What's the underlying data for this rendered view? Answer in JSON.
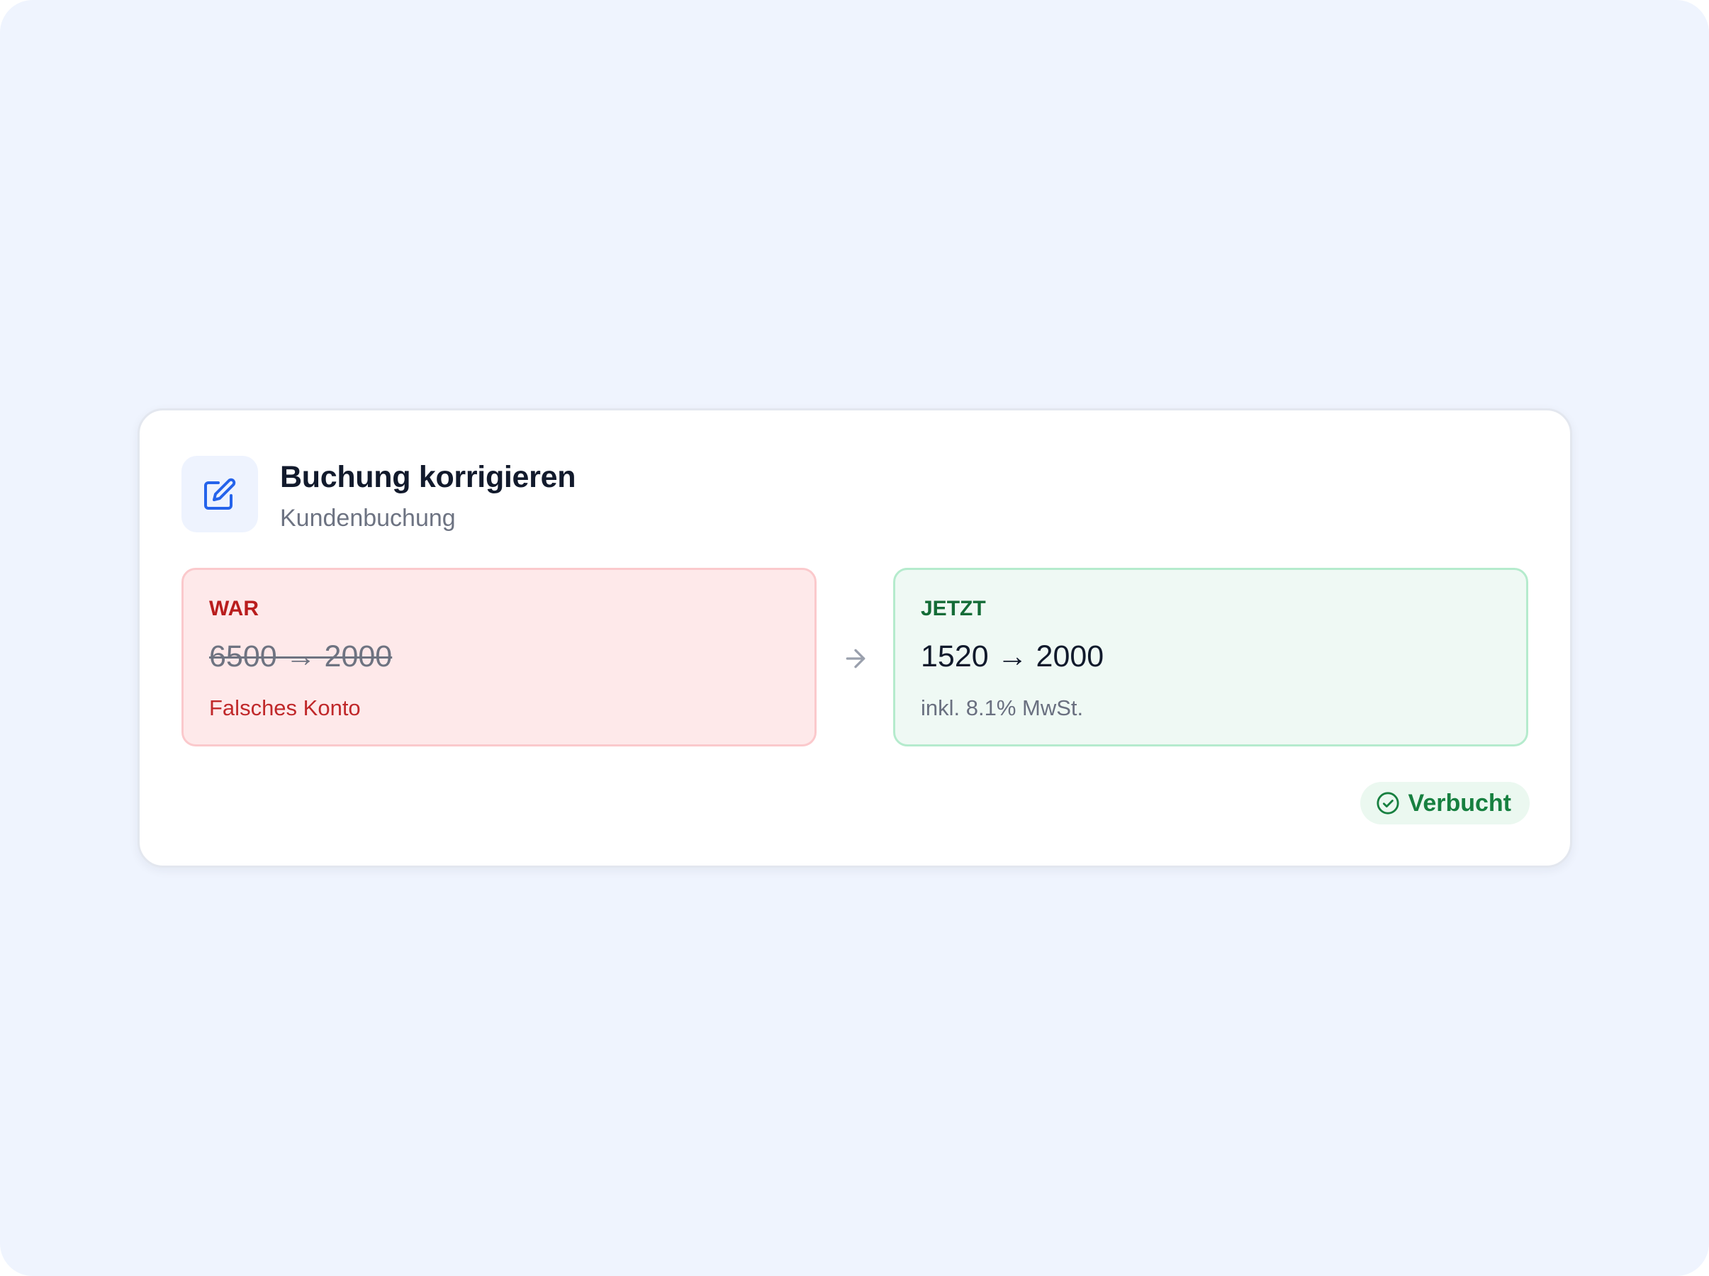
{
  "header": {
    "icon": "edit-icon",
    "title": "Buchung korrigieren",
    "subtitle": "Kundenbuchung"
  },
  "was": {
    "label": "WAR",
    "value": "6500 → 2000",
    "note": "Falsches Konto"
  },
  "transition_icon": "arrow-right-icon",
  "now": {
    "label": "JETZT",
    "value": "1520 → 2000",
    "note": "inkl. 8.1% MwSt."
  },
  "status": {
    "icon": "check-circle-icon",
    "label": "Verbucht"
  },
  "colors": {
    "accent": "#2563eb",
    "error": "#b91d1d",
    "success": "#178040",
    "background": "#eff4fe"
  }
}
